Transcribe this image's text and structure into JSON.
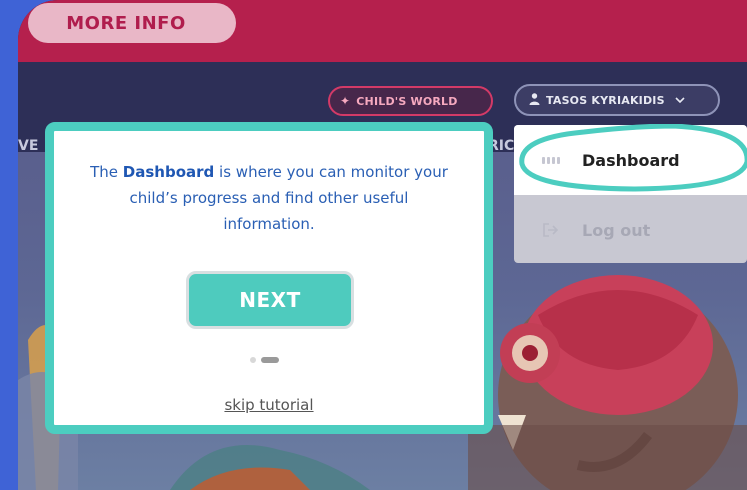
{
  "header": {
    "more_info_label": "MORE INFO",
    "childs_world_label": "CHILD'S WORLD",
    "user_name_label": "TASOS KYRIAKIDIS"
  },
  "background_text": {
    "left_fragment": "VE",
    "right_fragment": "RIC"
  },
  "user_menu": {
    "items": [
      {
        "label": "Dashboard",
        "icon": "dashboard-grid-icon"
      },
      {
        "label": "Log out",
        "icon": "logout-icon"
      }
    ]
  },
  "tutorial": {
    "text_before": "The ",
    "text_bold": "Dashboard",
    "text_after": " is where you can monitor your child’s progress and find other useful information.",
    "next_label": "NEXT",
    "skip_label": "skip tutorial",
    "step_current": 2,
    "step_total": 2
  },
  "colors": {
    "accent_teal": "#4ccdc0",
    "brand_magenta": "#b5204d",
    "text_blue": "#2a5fb4"
  }
}
